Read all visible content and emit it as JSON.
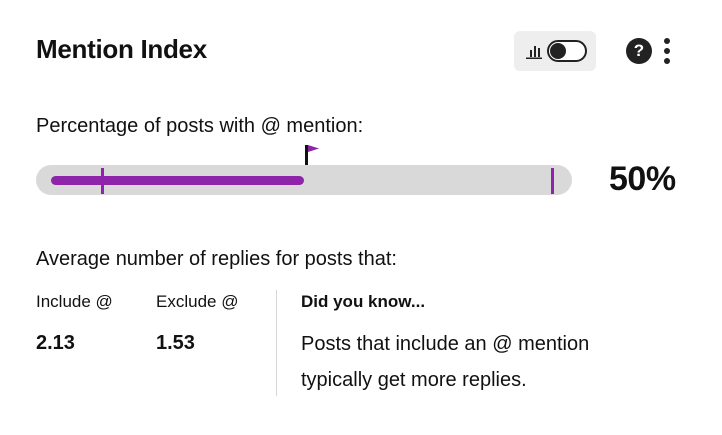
{
  "widget": {
    "title": "Mention Index",
    "toggle": {
      "on": false
    },
    "help_label": "?"
  },
  "percentage": {
    "label": "Percentage of posts with @ mention:",
    "value_text": "50%",
    "fill_fraction": 0.5,
    "marker_fraction": 0.5,
    "tick_fractions": [
      0.122,
      0.966
    ],
    "accent_color": "#8e24aa"
  },
  "replies": {
    "label": "Average number of replies for posts that:",
    "include_label": "Include @",
    "include_value": "2.13",
    "exclude_label": "Exclude @",
    "exclude_value": "1.53"
  },
  "did_you_know": {
    "title": "Did you know...",
    "line1": "Posts that include an @ mention",
    "line2": "typically get more replies."
  },
  "icons": {
    "chart": "bar-chart-icon",
    "toggle": "toggle-switch-icon",
    "help": "help-icon",
    "menu": "more-vertical-icon",
    "flag": "flag-icon"
  }
}
